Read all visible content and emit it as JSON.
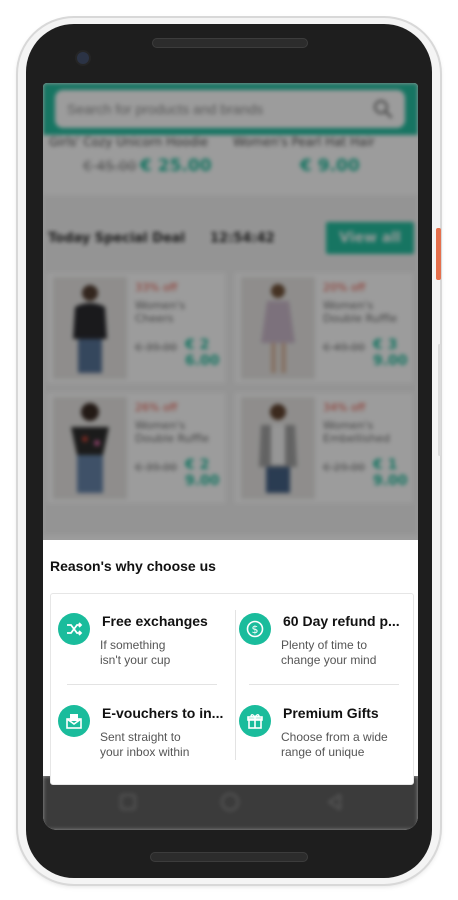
{
  "search": {
    "placeholder": "Search for products and brands"
  },
  "strip": {
    "items": [
      {
        "name": "Girls' Cozy Unicorn Hoodie",
        "old_price": "€ 45.00",
        "new_price": "€ 25.00"
      },
      {
        "name": "Women's Pearl Hat Hair",
        "old_price": "",
        "new_price": "€ 9.00"
      }
    ]
  },
  "deal": {
    "title": "Today Special Deal",
    "timer": "12:54:42",
    "view_all": "View all",
    "cards": [
      {
        "discount": "33% off",
        "name": "Women's Cheers",
        "old_price": "€ 39.00",
        "new_price": "€ 26.00"
      },
      {
        "discount": "20% off",
        "name": "Women's Double Ruffle",
        "old_price": "€ 49.00",
        "new_price": "€ 39.00"
      },
      {
        "discount": "26% off",
        "name": "Women's Double Ruffle",
        "old_price": "€ 39.00",
        "new_price": "€ 29.00"
      },
      {
        "discount": "34% off",
        "name": "Women's Embellished",
        "old_price": "€ 29.00",
        "new_price": "€ 19.00"
      }
    ]
  },
  "sheet": {
    "title": "Reason's why choose us",
    "reasons": [
      {
        "icon": "shuffle-icon",
        "title": "Free exchanges",
        "desc_line1": "If something",
        "desc_line2": "isn't your cup"
      },
      {
        "icon": "dollar-refund-icon",
        "title": "60 Day refund p...",
        "desc_line1": "Plenty of time to",
        "desc_line2": "change your mind"
      },
      {
        "icon": "envelope-icon",
        "title": "E-vouchers to in...",
        "desc_line1": "Sent straight to",
        "desc_line2": "your inbox within"
      },
      {
        "icon": "gift-icon",
        "title": "Premium Gifts",
        "desc_line1": "Choose from a wide",
        "desc_line2": "range of unique"
      }
    ]
  },
  "colors": {
    "accent": "#1abc9c",
    "discount": "#e74c3c",
    "navbar": "#585858"
  }
}
